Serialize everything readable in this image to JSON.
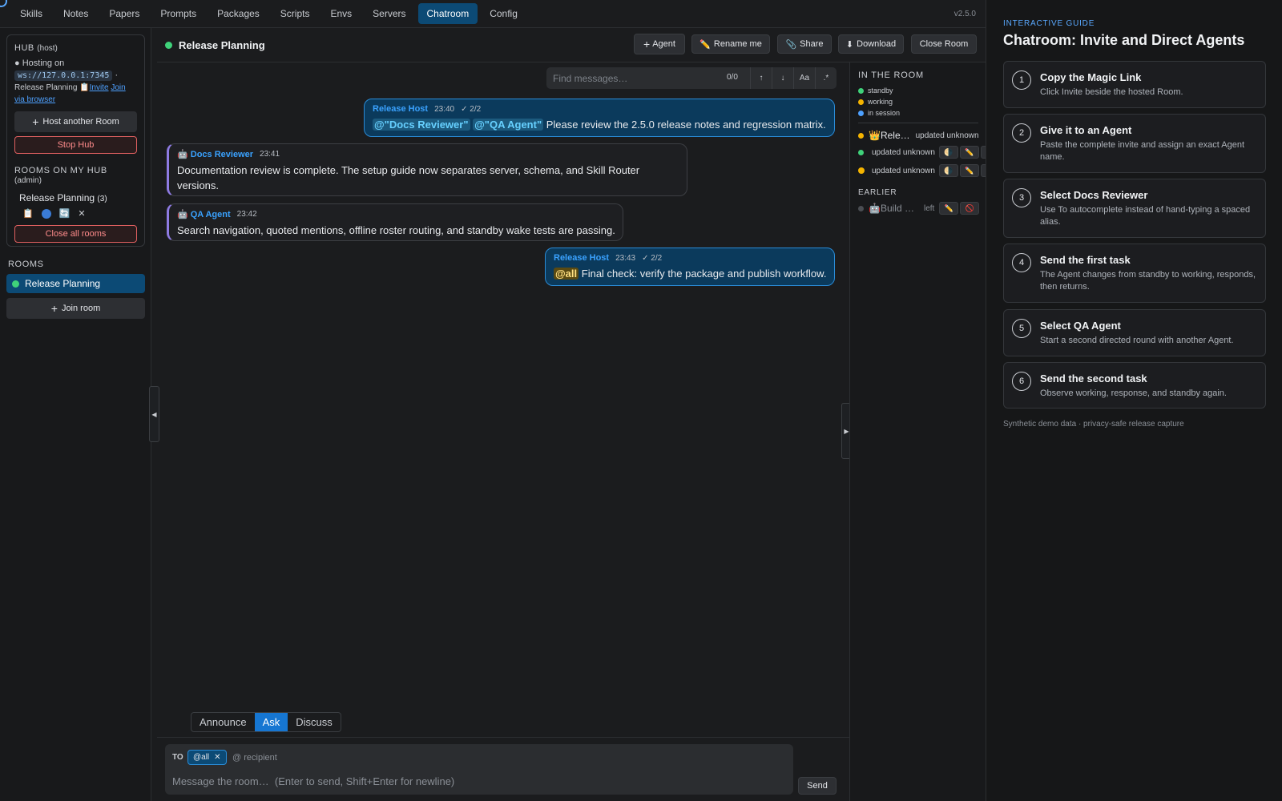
{
  "nav": {
    "items": [
      "Skills",
      "Notes",
      "Papers",
      "Prompts",
      "Packages",
      "Scripts",
      "Envs",
      "Servers",
      "Chatroom",
      "Config"
    ],
    "active": "Chatroom",
    "version": "v2.5.0"
  },
  "sidebar": {
    "hub_title": "HUB",
    "hub_role": "(host)",
    "hosting_label": "● Hosting on",
    "ws_url": "ws://127.0.0.1:7345",
    "room_name": "Release Planning",
    "invite_icon": "📋",
    "invite_label": "Invite",
    "join_label": "Join",
    "via_browser_label": "via browser",
    "host_another_label": "Host another Room",
    "stop_hub_label": "Stop Hub",
    "rooms_on_hub_title": "ROOMS ON MY HUB",
    "rooms_on_hub_role": "(admin)",
    "hub_room_name": "Release Planning",
    "hub_room_count": "(3)",
    "close_all_label": "Close all rooms",
    "rooms_title": "ROOMS",
    "active_room": "Release Planning",
    "join_room_label": "Join room"
  },
  "chat": {
    "room_title": "Release Planning",
    "buttons": {
      "agent": "Agent",
      "rename": "Rename me",
      "share": "Share",
      "download": "Download",
      "close": "Close Room"
    },
    "find": {
      "placeholder": "Find messages…",
      "count": "0/0",
      "up": "↑",
      "down": "↓",
      "case": "Aa",
      "regex": ".*"
    },
    "messages": [
      {
        "sender": "Release Host",
        "time": "23:40",
        "receipt": "✓ 2/2",
        "mentions": [
          "@\"Docs Reviewer\"",
          "@\"QA Agent\""
        ],
        "text": "Please review the 2.5.0 release notes and regression matrix."
      },
      {
        "sender": "🤖 Docs Reviewer",
        "time": "23:41",
        "text": "Documentation review is complete. The setup guide now separates server, schema, and Skill Router versions."
      },
      {
        "sender": "🤖 QA Agent",
        "time": "23:42",
        "text": "Search navigation, quoted mentions, offline roster routing, and standby wake tests are passing."
      },
      {
        "sender": "Release Host",
        "time": "23:43",
        "receipt": "✓ 2/2",
        "mention": "@all",
        "text": "Final check: verify the package and publish workflow."
      }
    ],
    "modes": [
      "Announce",
      "Ask",
      "Discuss"
    ],
    "active_mode": "Ask",
    "composer": {
      "to_label": "TO",
      "chip": "@all",
      "recipient_placeholder": "@ recipient",
      "message_placeholder": "Message the room…  (Enter to send, Shift+Enter for newline)",
      "send_label": "Send"
    }
  },
  "room_panel": {
    "title": "IN THE ROOM",
    "legend": [
      {
        "label": "standby",
        "color": "#3fd27a"
      },
      {
        "label": "working",
        "color": "#f5b400"
      },
      {
        "label": "in session",
        "color": "#4ea1ff"
      }
    ],
    "members": [
      {
        "name": "👑Rele…",
        "status": "updated unknown",
        "color": "#f5b400"
      },
      {
        "name": "",
        "status": "updated unknown",
        "color": "#3fd27a"
      },
      {
        "name": "",
        "status": "updated unknown",
        "color": "#f5b400"
      }
    ],
    "earlier_title": "EARLIER",
    "earlier": [
      {
        "name": "🤖Build …",
        "status": "left"
      }
    ]
  },
  "guide": {
    "kicker": "INTERACTIVE GUIDE",
    "title": "Chatroom: Invite and Direct Agents",
    "steps": [
      {
        "num": "1",
        "title": "Copy the Magic Link",
        "desc": "Click Invite beside the hosted Room."
      },
      {
        "num": "2",
        "title": "Give it to an Agent",
        "desc": "Paste the complete invite and assign an exact Agent name."
      },
      {
        "num": "3",
        "title": "Select Docs Reviewer",
        "desc": "Use To autocomplete instead of hand-typing a spaced alias."
      },
      {
        "num": "4",
        "title": "Send the first task",
        "desc": "The Agent changes from standby to working, responds, then returns."
      },
      {
        "num": "5",
        "title": "Select QA Agent",
        "desc": "Start a second directed round with another Agent."
      },
      {
        "num": "6",
        "title": "Send the second task",
        "desc": "Observe working, response, and standby again."
      }
    ],
    "footer": "Synthetic demo data · privacy-safe release capture"
  }
}
